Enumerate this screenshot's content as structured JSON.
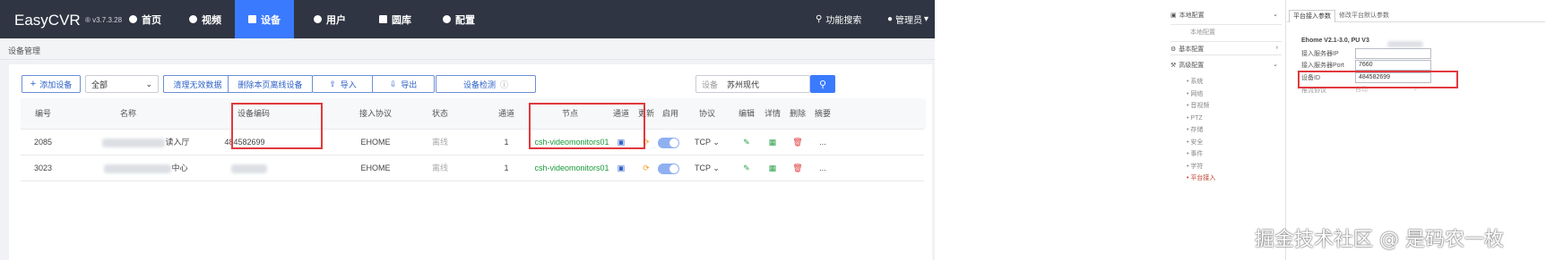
{
  "app": {
    "title": "EasyCVR",
    "version": "v3.7.3.28",
    "nav": [
      {
        "label": "首页",
        "icon": "dashboard-icon"
      },
      {
        "label": "视频",
        "icon": "play-icon"
      },
      {
        "label": "设备",
        "icon": "device-icon"
      },
      {
        "label": "用户",
        "icon": "user-icon"
      },
      {
        "label": "圆库",
        "icon": "library-icon"
      },
      {
        "label": "配置",
        "icon": "gear-icon"
      }
    ],
    "search_feature": "功能搜索",
    "admin": "管理员",
    "breadcrumb": "设备管理"
  },
  "toolbar": {
    "add_device": "添加设备",
    "filter_value": "全部",
    "clear_invalid": "清理无效数据",
    "delete_offline": "删除本页离线设备",
    "import": "导入",
    "export": "导出",
    "device_check": "设备检测",
    "search_label": "设备",
    "search_value": "苏州现代"
  },
  "table": {
    "headers": [
      "编号",
      "名称",
      "设备编码",
      "接入协议",
      "状态",
      "通道",
      "节点",
      "通道",
      "更新",
      "启用",
      "协议",
      "编辑",
      "详情",
      "删除",
      "摘要"
    ],
    "rows": [
      {
        "id": "2085",
        "name": "读入厅",
        "code": "484582699",
        "protocol": "EHOME",
        "status": "离线",
        "channels": "1",
        "node": "csh-videomonitors01",
        "transport": "TCP",
        "more": "..."
      },
      {
        "id": "3023",
        "name": "中心",
        "code": "",
        "protocol": "EHOME",
        "status": "离线",
        "channels": "1",
        "node": "csh-videomonitors01",
        "transport": "TCP",
        "more": "..."
      }
    ]
  },
  "settings": {
    "tree": [
      {
        "label": "本地配置",
        "children": [
          "本地配置"
        ]
      },
      {
        "label": "基本配置",
        "children": []
      },
      {
        "label": "高级配置",
        "children": [
          "系统",
          "网络",
          "音视频",
          "PTZ",
          "存储",
          "安全",
          "事件",
          "字符",
          "平台接入"
        ]
      }
    ],
    "tabs": [
      "平台接入参数",
      "修改平台默认参数"
    ],
    "ehome_version": "Ehome V2.1-3.0, PU V3",
    "field_labels": [
      "接入服务器IP",
      "接入服务器Port",
      "设备ID",
      "推流协议"
    ],
    "fields": {
      "port": "7660",
      "device_id": "484582699",
      "stream_protocol": "自动"
    }
  },
  "watermark": "掘金技术社区 @ 是码农一枚",
  "colors": {
    "topbar": "#2f3542",
    "accent": "#3a7afe",
    "highlight": "#e0393e",
    "node_text": "#1a9a3a"
  }
}
